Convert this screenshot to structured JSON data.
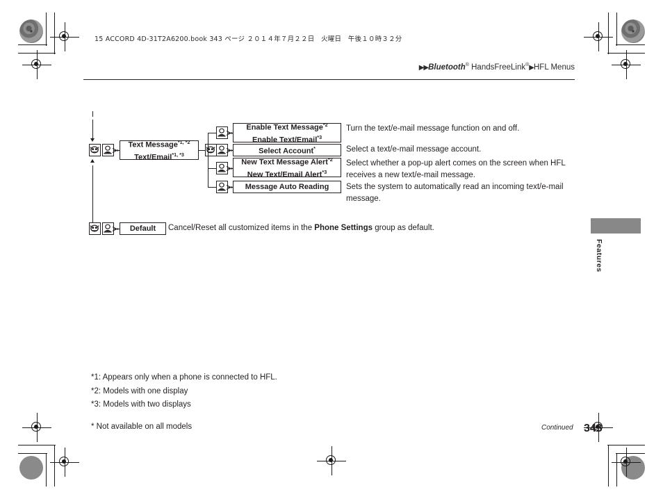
{
  "print_marks": {
    "book_info": "15 ACCORD 4D-31T2A6200.book  343 ページ  ２０１４年７月２２日　火曜日　午後１０時３２分"
  },
  "breadcrumb": {
    "arrow1": "▶▶",
    "item1": "Bluetooth",
    "item1_sup": "®",
    "item2": "HandsFreeLink",
    "item2_sup": "®",
    "arrow2": "▶",
    "item3": "HFL Menus"
  },
  "diagram": {
    "icons": {
      "pickup": "phone-pickup-button-icon",
      "talk": "talk-button-icon"
    },
    "nodes": [
      {
        "id": "text-message",
        "line1": "Text Message",
        "line1_sup": "*1, *2",
        "line2": "Text/Email",
        "line2_sup": "*1, *3",
        "description": ""
      },
      {
        "id": "enable-text-message",
        "line1": "Enable Text Message",
        "line1_sup": "*2",
        "line2": "Enable Text/Email",
        "line2_sup": "*3",
        "description": "Turn the text/e-mail message function on and off."
      },
      {
        "id": "select-account",
        "line1": "Select Account",
        "line1_sup": "*",
        "line2": "",
        "line2_sup": "",
        "description": "Select a text/e-mail message account."
      },
      {
        "id": "new-text-message-alert",
        "line1": "New Text Message Alert",
        "line1_sup": "*2",
        "line2": "New Text/Email Alert",
        "line2_sup": "*3",
        "description_part1": "Select whether a pop-up alert comes on the screen when HFL",
        "description_part2": "receives a new text/e-mail message."
      },
      {
        "id": "message-auto-reading",
        "line1": "Message Auto Reading",
        "line1_sup": "",
        "line2": "",
        "line2_sup": "",
        "description_part1": "Sets the system to automatically read an incoming text/e-mail",
        "description_part2": "message."
      },
      {
        "id": "default",
        "line1": "Default",
        "line1_sup": "",
        "line2": "",
        "line2_sup": "",
        "desc_before": "Cancel/Reset all customized items in the ",
        "desc_bold": "Phone Settings",
        "desc_after": " group as default."
      }
    ]
  },
  "footnotes": {
    "n1": "*1: Appears only when a phone is connected to HFL.",
    "n2": "*2: Models with one display",
    "n3": "*3: Models with two displays",
    "asterisk": "* Not available on all models"
  },
  "side_tab": {
    "label": "Features",
    "color": "#888888"
  },
  "footer": {
    "continued": "Continued",
    "page_number": "343"
  }
}
